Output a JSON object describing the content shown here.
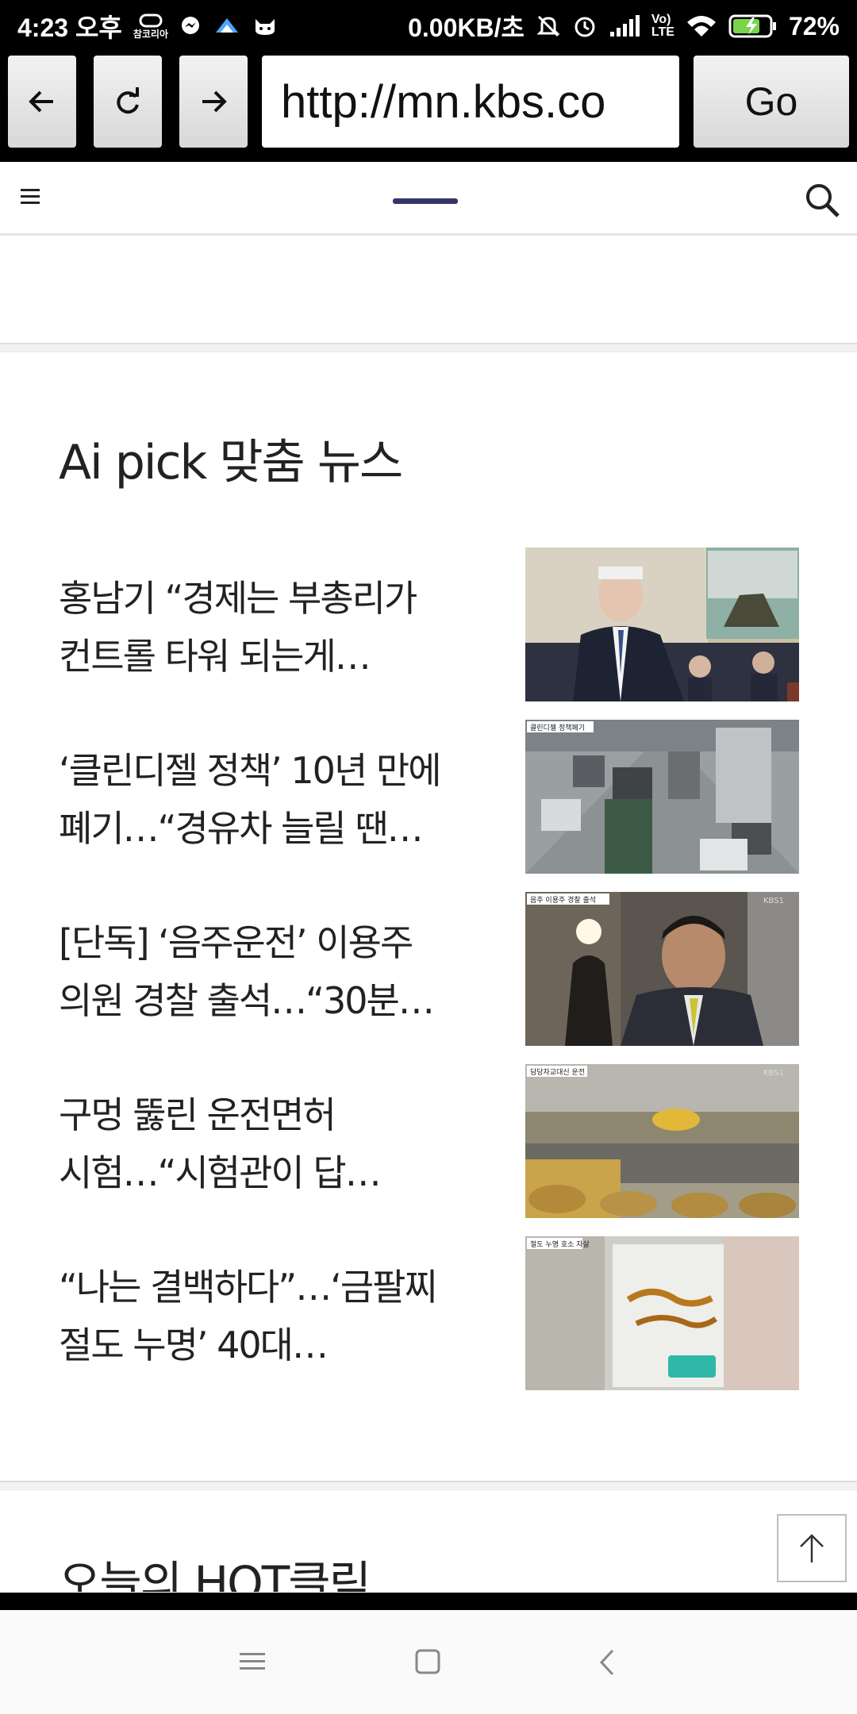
{
  "status_bar": {
    "time": "4:23 오후",
    "carrier_label": "참코리아",
    "network_speed": "0.00KB/초",
    "lte_top": "Vo)",
    "lte_bottom": "LTE",
    "battery": "72%"
  },
  "browser": {
    "back_icon": "arrow-left-icon",
    "reload_icon": "reload-icon",
    "forward_icon": "arrow-right-icon",
    "url": "http://mn.kbs.co",
    "go_label": "Go"
  },
  "site_header": {
    "menu_icon": "hamburger-menu-icon",
    "search_icon": "search-icon",
    "logo_color": "#36356a"
  },
  "ai_pick": {
    "title": "Ai pick 맞춤 뉴스",
    "items": [
      {
        "line1": "홍남기 “경제는 부총리가",
        "line2": "컨트롤 타워 되는게…"
      },
      {
        "line1": "‘클린디젤 정책’ 10년 만에",
        "line2": "폐기…“경유차 늘릴 땐…"
      },
      {
        "line1": "[단독] ‘음주운전’ 이용주",
        "line2": "의원 경찰 출석…“30분…"
      },
      {
        "line1": "구멍 뚫린 운전면허",
        "line2": "시험…“시험관이 답…"
      },
      {
        "line1": "“나는 결백하다”…‘금팔찌",
        "line2": "절도 누명’ 40대…"
      }
    ],
    "thumb_captions": [
      "",
      "클린디젤 정책폐기",
      "음주 이용주 경찰 출석",
      "담당자교대신 운전",
      "절도 누명 호소 자살"
    ],
    "thumb_badge": "KBS1"
  },
  "hot_section": {
    "title": "오늘의 HOT클릭",
    "top_icon": "arrow-up-icon"
  },
  "nav_bar": {
    "menu_icon": "recent-apps-icon",
    "home_icon": "home-icon",
    "back_icon": "back-chevron-icon"
  }
}
